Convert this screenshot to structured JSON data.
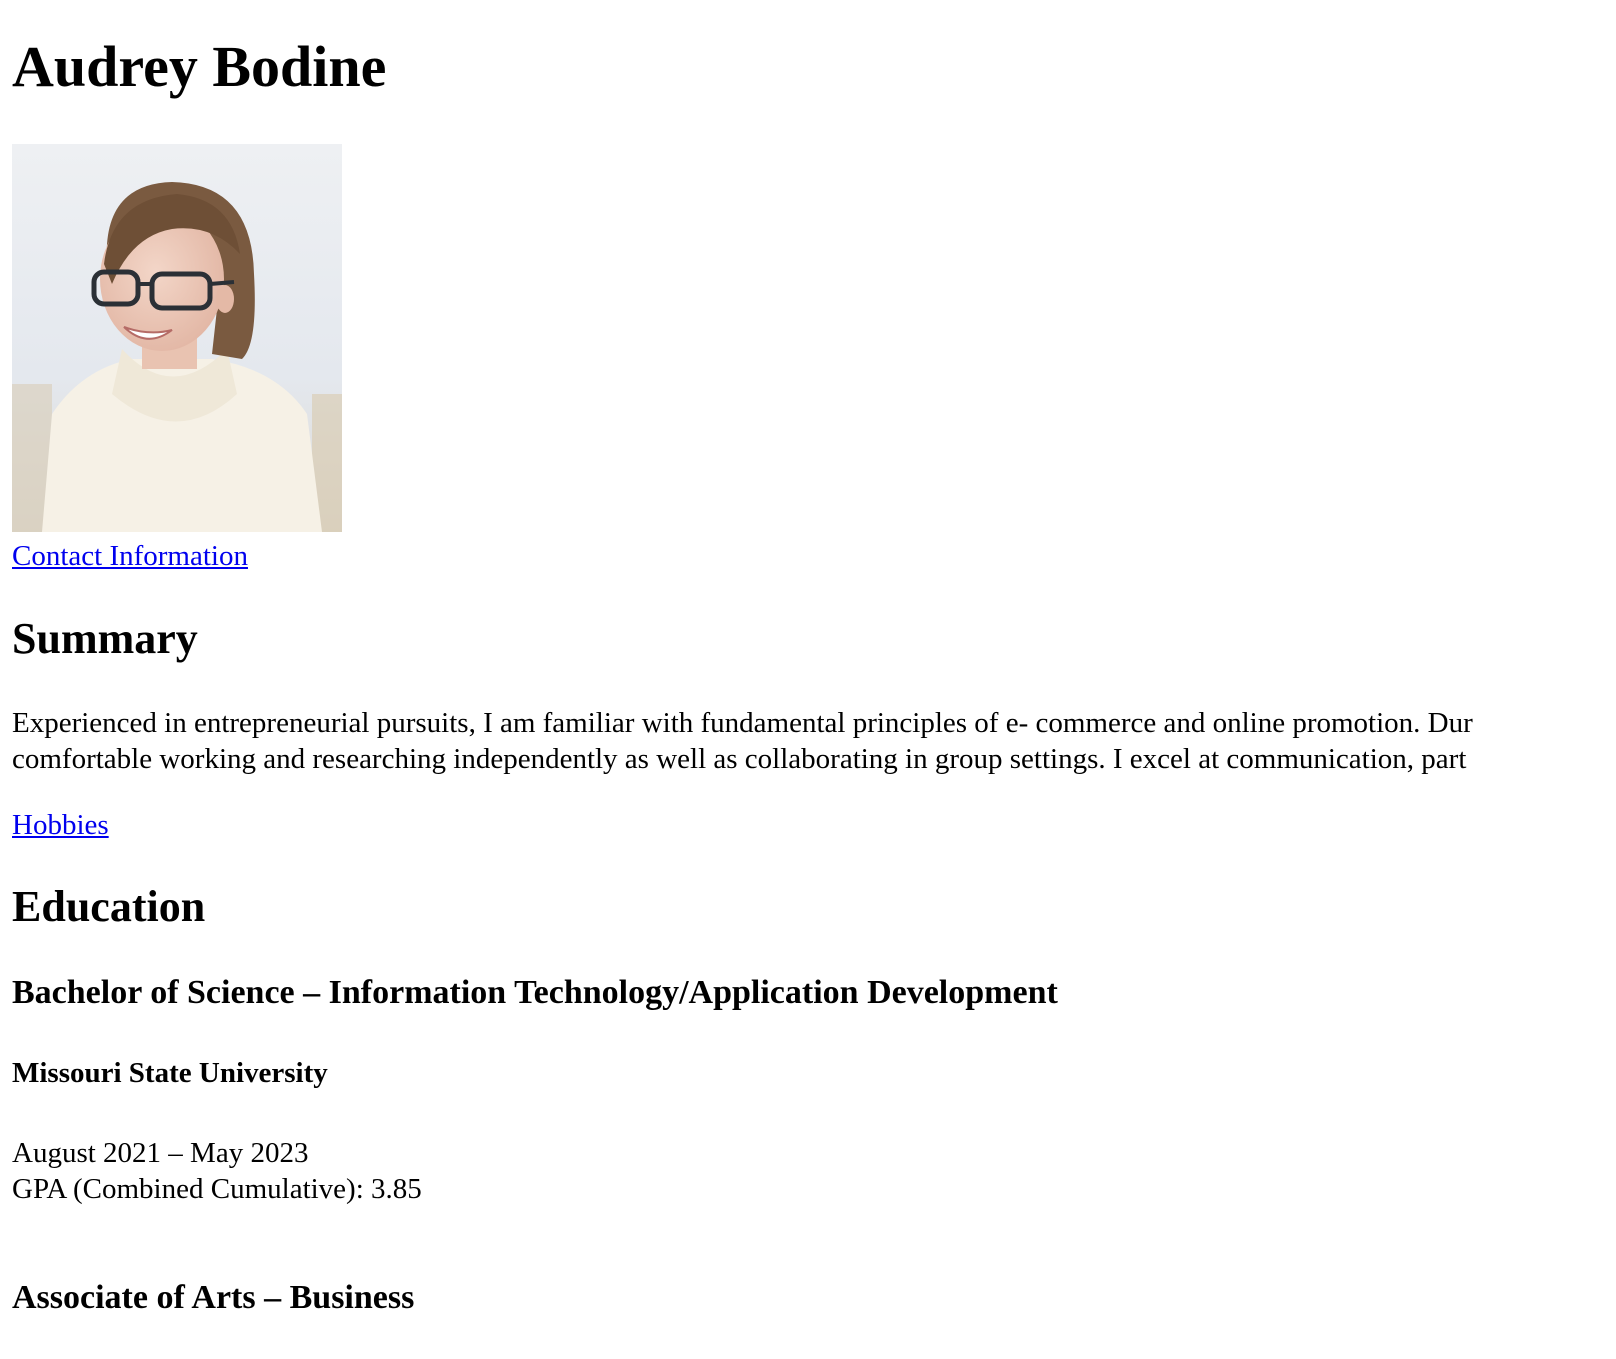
{
  "header": {
    "name": "Audrey Bodine"
  },
  "photo": {
    "alt": "Audrey Bodine"
  },
  "links": {
    "contact": "Contact Information",
    "hobbies": "Hobbies"
  },
  "summary": {
    "heading": "Summary",
    "line1": "Experienced in entrepreneurial pursuits, I am familiar with fundamental principles of e- commerce and online promotion. Dur",
    "line2": "comfortable working and researching independently as well as collaborating in group settings. I excel at communication, part"
  },
  "education": {
    "heading": "Education",
    "entries": [
      {
        "degree": "Bachelor of Science – Information Technology/Application Development",
        "school": "Missouri State University",
        "dates": "August 2021 – May 2023",
        "gpa": "GPA (Combined Cumulative): 3.85"
      },
      {
        "degree": "Associate of Arts – Business"
      }
    ]
  },
  "colors": {
    "link": "#0000ee",
    "text": "#000000",
    "background": "#ffffff"
  }
}
